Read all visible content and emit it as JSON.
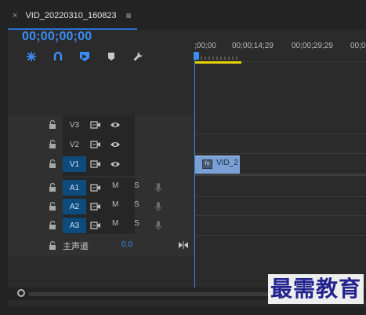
{
  "sequence_tab": {
    "title": "VID_20220310_160823",
    "close_glyph": "×",
    "menu_glyph": "≡"
  },
  "timecode": "00;00;00;00",
  "toolbar": {
    "icons": [
      "snap-icon",
      "linked-selection-icon",
      "add-marker-icon",
      "marker-icon",
      "settings-wrench-icon"
    ]
  },
  "ruler": {
    "labels": [
      ";00;00",
      "00;00;14;29",
      "00;00;29;29",
      "00;0"
    ]
  },
  "video_tracks": [
    {
      "label": "V3",
      "active": false
    },
    {
      "label": "V2",
      "active": false
    },
    {
      "label": "V1",
      "active": true
    }
  ],
  "audio_tracks": [
    {
      "label": "A1",
      "mute": "M",
      "solo": "S"
    },
    {
      "label": "A2",
      "mute": "M",
      "solo": "S"
    },
    {
      "label": "A3",
      "mute": "M",
      "solo": "S"
    }
  ],
  "master": {
    "label": "主声道",
    "value": "0.0"
  },
  "clip": {
    "name": "VID_2",
    "fx": "fx"
  },
  "watermark": "最需教育",
  "colors": {
    "accent": "#3b8ef6",
    "work_area": "#e4d200",
    "clip": "#7aa0d6",
    "track_active": "#0e4b7d"
  }
}
